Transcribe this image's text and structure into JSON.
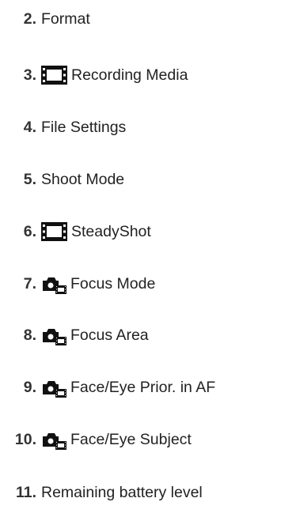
{
  "items": [
    {
      "number": "2.",
      "label": "Format",
      "icon": ""
    },
    {
      "number": "3.",
      "label": "Recording Media",
      "icon": "movie-film-icon"
    },
    {
      "number": "4.",
      "label": "File Settings",
      "icon": ""
    },
    {
      "number": "5.",
      "label": "Shoot Mode",
      "icon": ""
    },
    {
      "number": "6.",
      "label": "SteadyShot",
      "icon": "movie-film-icon"
    },
    {
      "number": "7.",
      "label": "Focus Mode",
      "icon": "still-movie-icon"
    },
    {
      "number": "8.",
      "label": "Focus Area",
      "icon": "still-movie-icon"
    },
    {
      "number": "9.",
      "label": "Face/Eye Prior. in AF",
      "icon": "still-movie-icon"
    },
    {
      "number": "10.",
      "label": "Face/Eye Subject",
      "icon": "still-movie-icon"
    },
    {
      "number": "11.",
      "label": "Remaining battery level",
      "icon": ""
    }
  ]
}
